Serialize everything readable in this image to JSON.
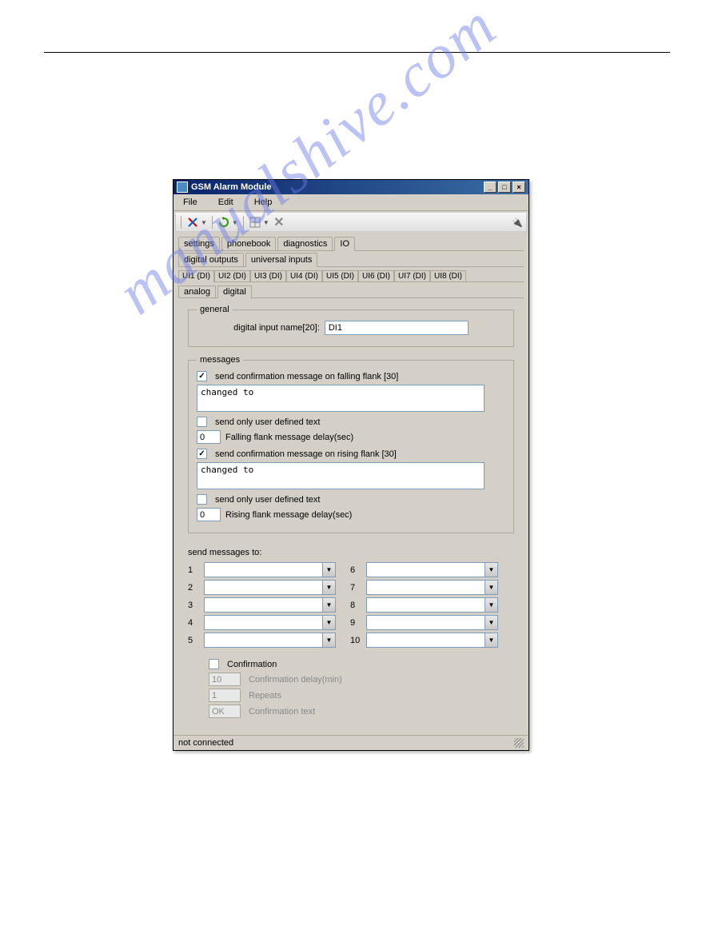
{
  "watermark": "manualshive.com",
  "window": {
    "title": "GSM Alarm Module"
  },
  "menu": {
    "file": "File",
    "edit": "Edit",
    "help": "Help"
  },
  "tabs": {
    "main": [
      "settings",
      "phonebook",
      "diagnostics",
      "IO"
    ],
    "main_active": 3,
    "sub": [
      "digital outputs",
      "universal inputs"
    ],
    "sub_active": 1,
    "ui": [
      "UI1 (DI)",
      "UI2 (DI)",
      "UI3 (DI)",
      "UI4 (DI)",
      "UI5 (DI)",
      "UI6 (DI)",
      "UI7 (DI)",
      "UI8 (DI)"
    ],
    "ui_active": 0,
    "mode": [
      "analog",
      "digital"
    ],
    "mode_active": 1
  },
  "general": {
    "legend": "general",
    "label": "digital input name[20]:",
    "value": "DI1"
  },
  "messages": {
    "legend": "messages",
    "falling_check": "send confirmation message on falling flank [30]",
    "falling_text": "changed to",
    "falling_userdef": "send only user defined text",
    "falling_delay_val": "0",
    "falling_delay_label": "Falling flank message delay(sec)",
    "rising_check": "send confirmation message on rising flank [30]",
    "rising_text": "changed to",
    "rising_userdef": "send only user defined text",
    "rising_delay_val": "0",
    "rising_delay_label": "Rising flank message delay(sec)"
  },
  "sendto": {
    "label": "send messages to:",
    "left": [
      "1",
      "2",
      "3",
      "4",
      "5"
    ],
    "right": [
      "6",
      "7",
      "8",
      "9",
      "10"
    ]
  },
  "confirmation": {
    "checkbox": "Confirmation",
    "delay_val": "10",
    "delay_label": "Confirmation delay(min)",
    "repeats_val": "1",
    "repeats_label": "Repeats",
    "text_val": "OK",
    "text_label": "Confirmation text"
  },
  "status": "not connected"
}
